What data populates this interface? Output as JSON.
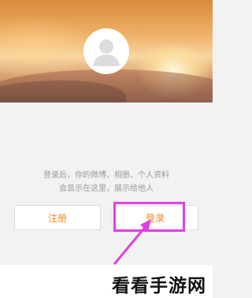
{
  "profile": {
    "avatar_icon": "default-user-avatar-icon",
    "info_line1": "登录后，你的微博、相册、个人资料",
    "info_line2": "会显示在这里，展示给他人"
  },
  "actions": {
    "register_label": "注册",
    "login_label": "登录"
  },
  "annotation": {
    "highlight_color": "#e040e0",
    "highlight_target": "login-button"
  },
  "watermark": {
    "text": "看看手游网"
  },
  "colors": {
    "accent_text": "#f08a24",
    "info_text": "#9a9a9a",
    "background": "#f2f2f2"
  }
}
